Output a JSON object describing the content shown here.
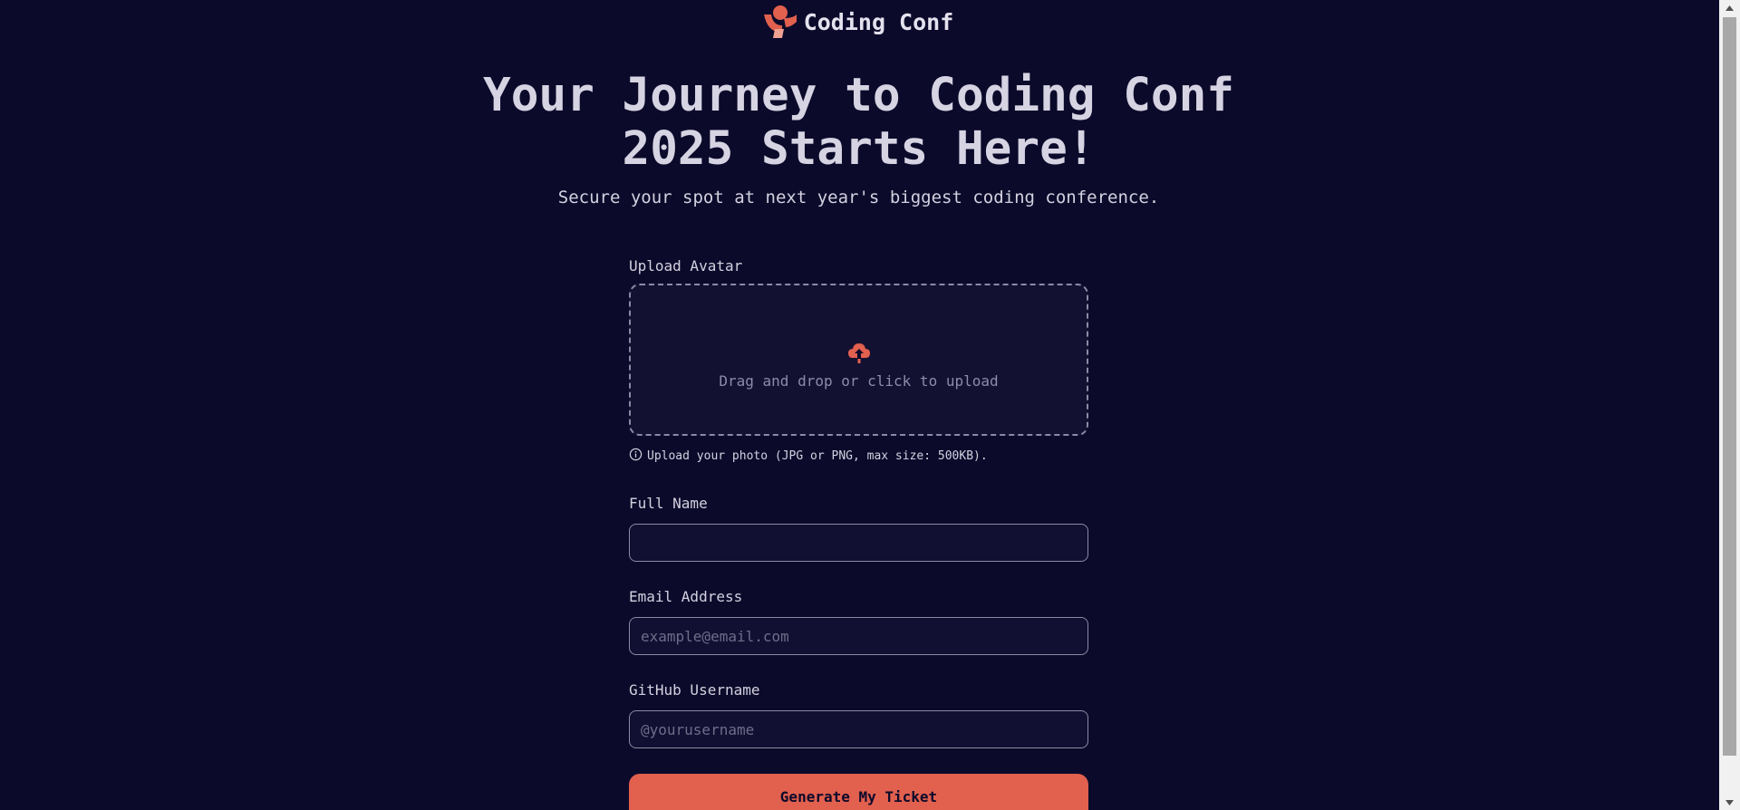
{
  "brand": {
    "name": "Coding Conf",
    "logo_icon": "coding-conf-logo-icon",
    "accent_color": "#e1604e"
  },
  "hero": {
    "title_line1": "Your Journey to Coding Conf",
    "title_line2": "2025 Starts Here!",
    "subtitle": "Secure your spot at next year's biggest coding conference."
  },
  "form": {
    "avatar": {
      "label": "Upload Avatar",
      "dropzone_text": "Drag and drop or click to upload",
      "icon": "upload-cloud-icon",
      "hint": "Upload your photo (JPG or PNG, max size: 500KB).",
      "hint_icon": "info-icon"
    },
    "full_name": {
      "label": "Full Name",
      "value": "",
      "placeholder": ""
    },
    "email": {
      "label": "Email Address",
      "value": "",
      "placeholder": "example@email.com"
    },
    "github": {
      "label": "GitHub Username",
      "value": "",
      "placeholder": "@yourusername"
    },
    "submit_label": "Generate My Ticket"
  },
  "colors": {
    "background": "#0c0a2b",
    "text": "#d3d1df",
    "muted": "#8d8ba8",
    "border": "#8c8aa3"
  }
}
